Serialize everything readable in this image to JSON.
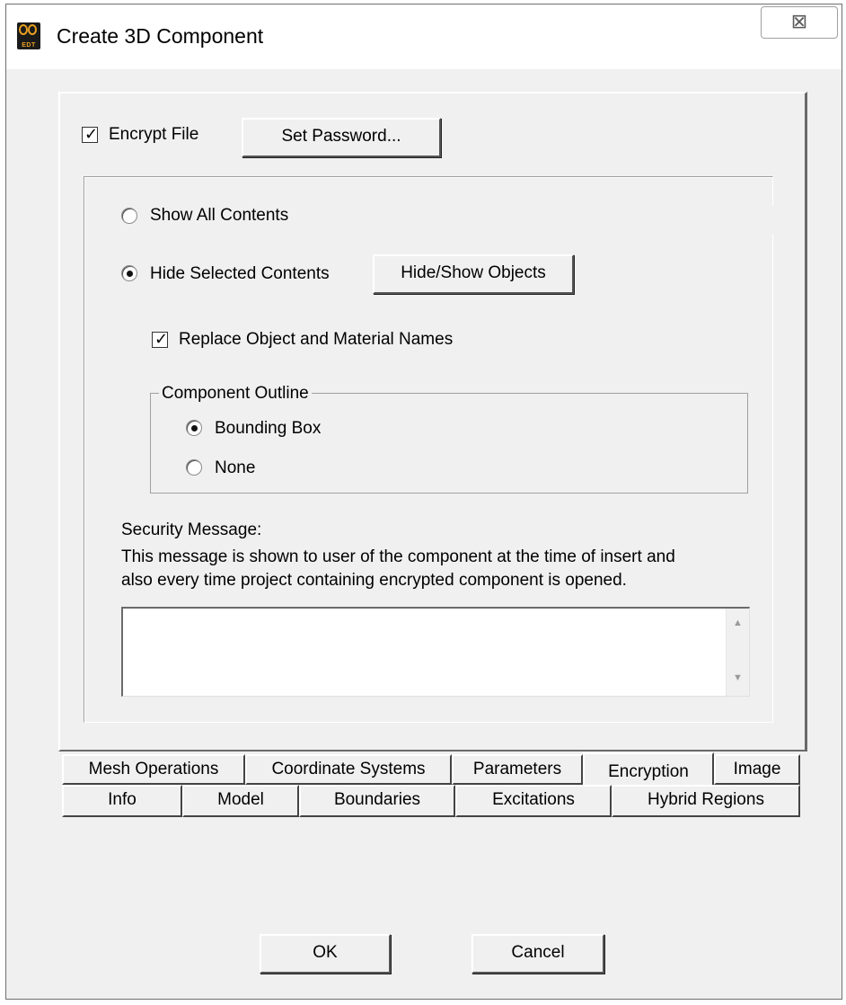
{
  "window": {
    "title": "Create 3D Component",
    "icon_text": "EDT",
    "close_glyph": "⊠"
  },
  "encryption": {
    "encrypt_file_label": "Encrypt File",
    "encrypt_file_checked": true,
    "set_password_button": "Set Password...",
    "show_all_label": "Show All Contents",
    "hide_selected_label": "Hide Selected Contents",
    "visibility_mode": "hide_selected",
    "hide_show_button": "Hide/Show Objects",
    "replace_names_label": "Replace Object and Material Names",
    "replace_names_checked": true,
    "outline": {
      "legend": "Component Outline",
      "bounding_box_label": "Bounding Box",
      "none_label": "None",
      "selected": "bounding_box"
    },
    "security_message_label": "Security Message:",
    "security_message_desc_line1": "This message is shown to user of the component at the time of insert and",
    "security_message_desc_line2": "also every time project containing encrypted component is opened.",
    "security_message_value": ""
  },
  "tabs": {
    "row_top": [
      "Mesh Operations",
      "Coordinate Systems",
      "Parameters",
      "Encryption",
      "Image"
    ],
    "row_bottom": [
      "Info",
      "Model",
      "Boundaries",
      "Excitations",
      "Hybrid Regions"
    ],
    "active": "Encryption"
  },
  "buttons": {
    "ok": "OK",
    "cancel": "Cancel"
  },
  "icons": {
    "check": "✓",
    "scroll_up": "▲",
    "scroll_down": "▼"
  }
}
